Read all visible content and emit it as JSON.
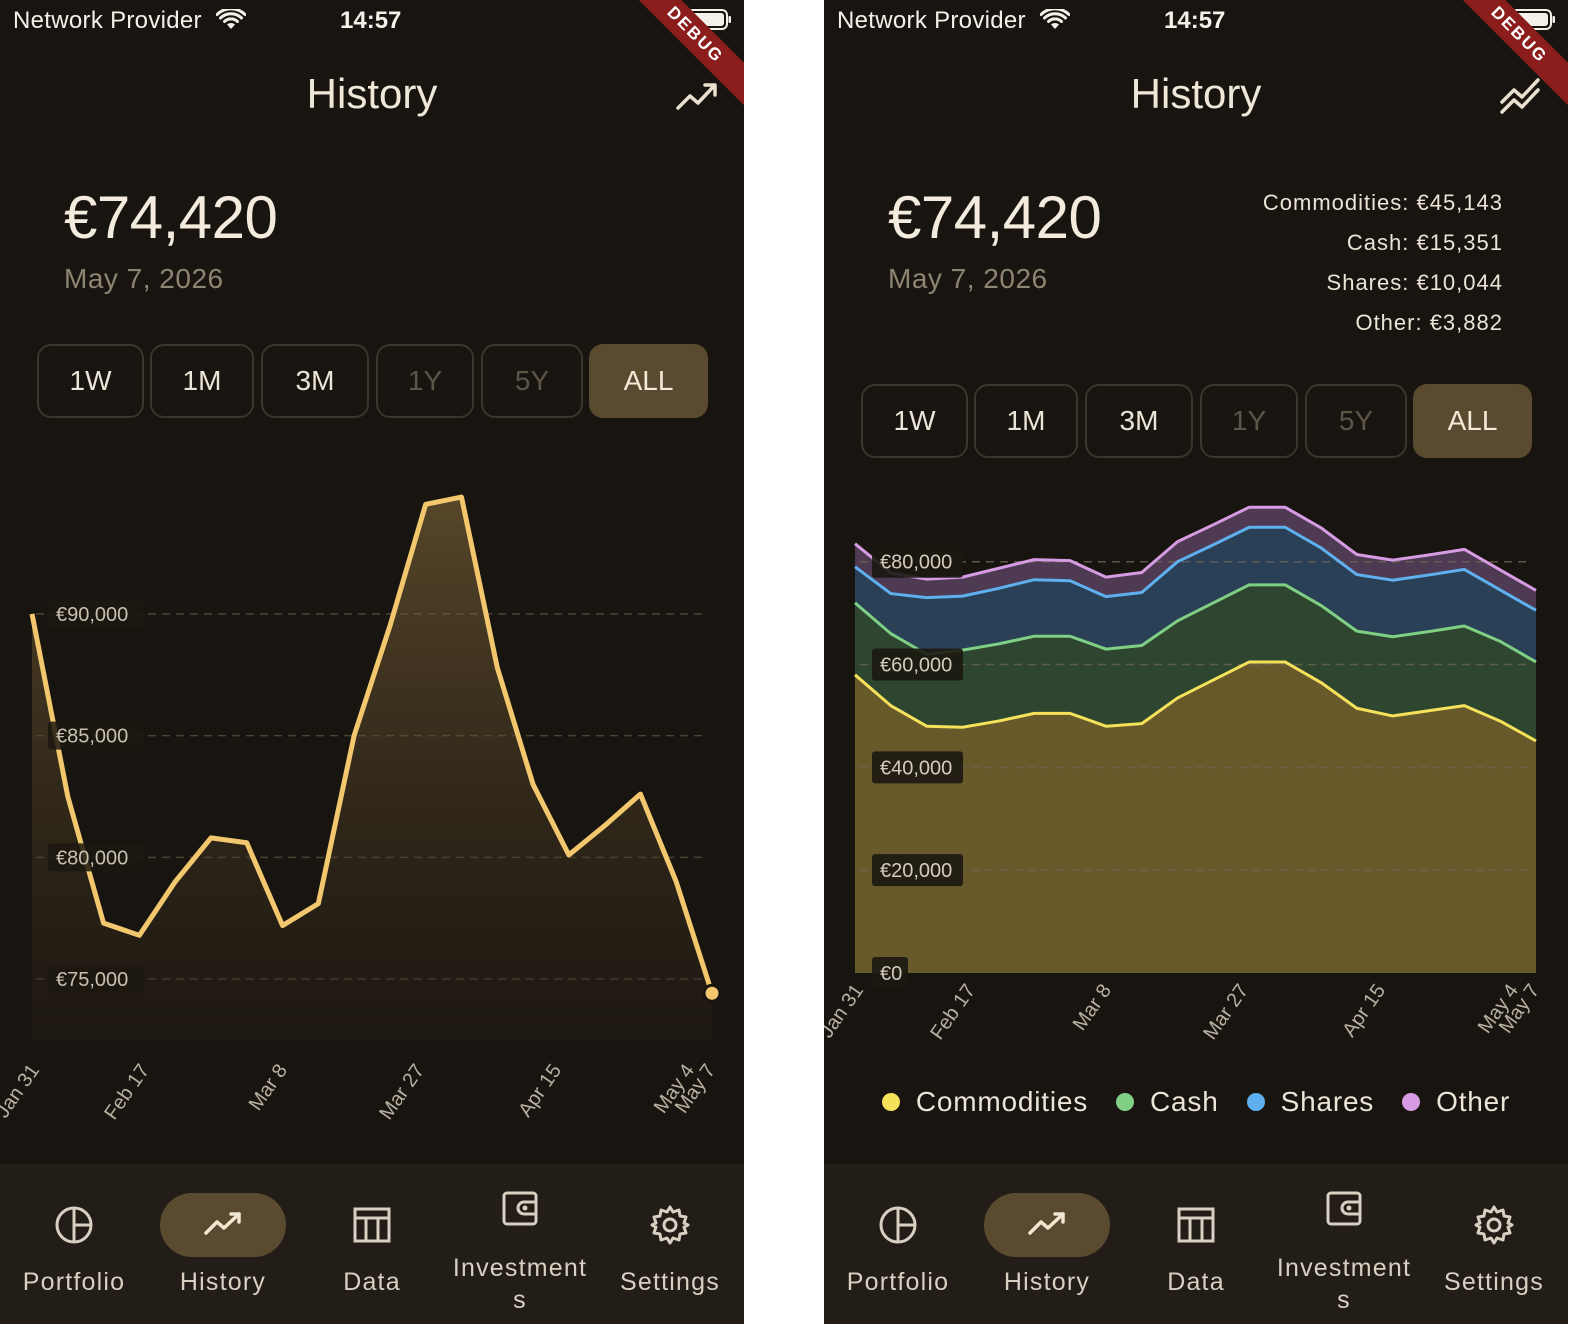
{
  "status_bar": {
    "carrier": "Network Provider",
    "time": "14:57"
  },
  "debug_banner": "DEBUG",
  "header": {
    "title": "History",
    "left_action_icon": "trending-up-icon",
    "right_action_icon": "stacked-trend-icon"
  },
  "summary": {
    "total": "€74,420",
    "date": "May 7, 2026"
  },
  "breakdown": [
    "Commodities: €45,143",
    "Cash: €15,351",
    "Shares: €10,044",
    "Other: €3,882"
  ],
  "ranges": [
    {
      "label": "1W",
      "state": "enabled"
    },
    {
      "label": "1M",
      "state": "enabled"
    },
    {
      "label": "3M",
      "state": "enabled"
    },
    {
      "label": "1Y",
      "state": "disabled"
    },
    {
      "label": "5Y",
      "state": "disabled"
    },
    {
      "label": "ALL",
      "state": "active"
    }
  ],
  "colors": {
    "background": "#18140f",
    "line": "#f2c76e",
    "commodities": "#f5e15a",
    "cash": "#7fcf85",
    "shares": "#5fb0ee",
    "other": "#d69be3",
    "active": "#5a4a30"
  },
  "chart_data": [
    {
      "type": "line",
      "x": [
        "Jan 31",
        "Feb 3",
        "Feb 7",
        "Feb 13",
        "Feb 17",
        "Feb 21",
        "Feb 26",
        "Mar 2",
        "Mar 8",
        "Mar 12",
        "Mar 16",
        "Mar 20",
        "Mar 24",
        "Mar 27",
        "Mar 31",
        "Apr 3",
        "Apr 7",
        "Apr 11",
        "Apr 15",
        "Apr 19",
        "Apr 23",
        "Apr 28",
        "May 4",
        "May 7"
      ],
      "values": [
        90000,
        82500,
        77300,
        76800,
        79000,
        80800,
        80600,
        77200,
        78100,
        85000,
        89500,
        94500,
        94800,
        87800,
        83000,
        80100,
        81300,
        82600,
        79000,
        74420
      ],
      "x_ticks": [
        "Jan 31",
        "Feb 17",
        "Mar 8",
        "Mar 27",
        "Apr 15",
        "May 4",
        "May 7"
      ],
      "y_ticks": [
        "€90,000",
        "€85,000",
        "€80,000",
        "€75,000"
      ],
      "ylim": [
        72500,
        95500
      ],
      "grid": true,
      "end_marker": true
    },
    {
      "type": "area",
      "stacked": true,
      "x_ticks": [
        "Jan 31",
        "Feb 17",
        "Mar 8",
        "Mar 27",
        "Apr 15",
        "May 4",
        "May 7"
      ],
      "y_ticks": [
        "€80,000",
        "€60,000",
        "€40,000",
        "€20,000",
        "€0"
      ],
      "ylim": [
        0,
        92000
      ],
      "grid": true,
      "legend_position": "bottom",
      "series": [
        {
          "name": "Commodities",
          "values": [
            58000,
            52000,
            48000,
            47800,
            49000,
            50500,
            50500,
            48000,
            48500,
            53500,
            57000,
            60500,
            60500,
            56500,
            51500,
            50000,
            51000,
            52000,
            49000,
            45143
          ]
        },
        {
          "name": "Cash",
          "values": [
            14000,
            14000,
            14000,
            15000,
            15000,
            15000,
            15000,
            15000,
            15200,
            15000,
            15000,
            15000,
            15000,
            15000,
            15000,
            15400,
            15400,
            15500,
            15500,
            15351
          ]
        },
        {
          "name": "Shares",
          "values": [
            7000,
            7800,
            11000,
            10500,
            10800,
            11000,
            10800,
            10200,
            10300,
            11500,
            11300,
            11200,
            11200,
            11200,
            11000,
            11000,
            11000,
            11000,
            10000,
            10044
          ]
        },
        {
          "name": "Other",
          "values": [
            4500,
            4000,
            3600,
            3700,
            3900,
            3900,
            3900,
            3800,
            3900,
            3900,
            3900,
            3900,
            3900,
            3900,
            3900,
            3900,
            3900,
            3900,
            3900,
            3882
          ]
        }
      ]
    }
  ],
  "nav": [
    {
      "label": "Portfolio",
      "icon": "pie-chart-icon",
      "active": false
    },
    {
      "label": "History",
      "icon": "trending-up-icon",
      "active": true
    },
    {
      "label": "Data",
      "icon": "table-icon",
      "active": false
    },
    {
      "label": "Investments",
      "icon": "wallet-icon",
      "active": false
    },
    {
      "label": "Settings",
      "icon": "settings-icon",
      "active": false
    }
  ]
}
